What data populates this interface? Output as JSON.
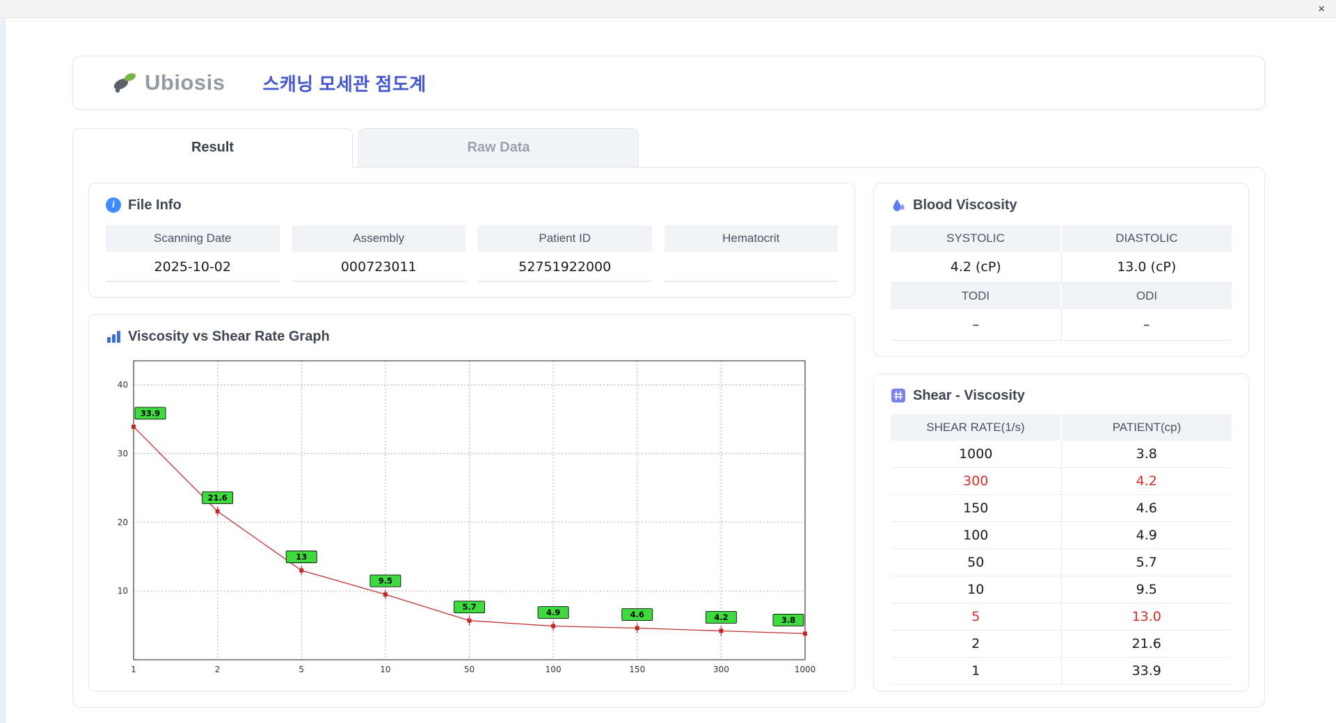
{
  "window": {
    "close_label": "×"
  },
  "header": {
    "logo_text": "Ubiosis",
    "app_title": "스캐닝 모세관 점도계"
  },
  "tabs": {
    "result": "Result",
    "raw": "Raw Data"
  },
  "icons": {
    "info_glyph": "i"
  },
  "file_info": {
    "title": "File Info",
    "fields": [
      {
        "label": "Scanning Date",
        "value": "2025-10-02"
      },
      {
        "label": "Assembly",
        "value": "000723011"
      },
      {
        "label": "Patient ID",
        "value": "52751922000"
      },
      {
        "label": "Hematocrit",
        "value": ""
      }
    ]
  },
  "blood_viscosity": {
    "title": "Blood Viscosity",
    "sections": [
      {
        "headers": [
          "SYSTOLIC",
          "DIASTOLIC"
        ],
        "values": [
          "4.2 (cP)",
          "13.0 (cP)"
        ]
      },
      {
        "headers": [
          "TODI",
          "ODI"
        ],
        "values": [
          "–",
          "–"
        ]
      }
    ]
  },
  "graph": {
    "title": "Viscosity vs Shear Rate Graph"
  },
  "chart_data": {
    "type": "line",
    "title": "Viscosity vs Shear Rate Graph",
    "xlabel": "",
    "ylabel": "",
    "x": [
      1,
      2,
      5,
      10,
      50,
      100,
      150,
      300,
      1000
    ],
    "x_scale": "category-ticks",
    "values": [
      33.9,
      21.6,
      13,
      9.5,
      5.7,
      4.9,
      4.6,
      4.2,
      3.8
    ],
    "point_labels": [
      "33.9",
      "21.6",
      "13",
      "9.5",
      "5.7",
      "4.9",
      "4.6",
      "4.2",
      "3.8"
    ],
    "ylim": [
      0,
      43.5
    ],
    "yticks": [
      10,
      20,
      30,
      40
    ],
    "grid": true,
    "legend": "none",
    "line_color": "#c03030",
    "marker_color": "#c62828",
    "label_bg": "#3ddb3d"
  },
  "shear_table": {
    "title": "Shear - Viscosity",
    "columns": [
      "SHEAR RATE(1/s)",
      "PATIENT(cp)"
    ],
    "rows": [
      {
        "shear": "1000",
        "patient": "3.8",
        "highlight": false
      },
      {
        "shear": "300",
        "patient": "4.2",
        "highlight": true
      },
      {
        "shear": "150",
        "patient": "4.6",
        "highlight": false
      },
      {
        "shear": "100",
        "patient": "4.9",
        "highlight": false
      },
      {
        "shear": "50",
        "patient": "5.7",
        "highlight": false
      },
      {
        "shear": "10",
        "patient": "9.5",
        "highlight": false
      },
      {
        "shear": "5",
        "patient": "13.0",
        "highlight": true
      },
      {
        "shear": "2",
        "patient": "21.6",
        "highlight": false
      },
      {
        "shear": "1",
        "patient": "33.9",
        "highlight": false
      }
    ]
  },
  "colors": {
    "accent_blue": "#4355cf",
    "highlight_red": "#d02c2c",
    "label_green": "#3ddb3d",
    "header_gray": "#f2f3f6"
  }
}
